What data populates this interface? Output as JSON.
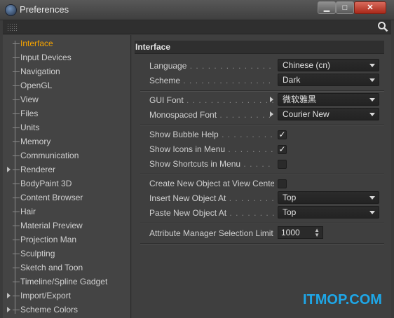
{
  "window": {
    "title": "Preferences",
    "min": "▁",
    "max": "□",
    "close": "✕"
  },
  "sidebar": {
    "items": [
      {
        "label": "Interface",
        "active": true
      },
      {
        "label": "Input Devices"
      },
      {
        "label": "Navigation"
      },
      {
        "label": "OpenGL"
      },
      {
        "label": "View"
      },
      {
        "label": "Files"
      },
      {
        "label": "Units"
      },
      {
        "label": "Memory"
      },
      {
        "label": "Communication"
      },
      {
        "label": "Renderer",
        "expandable": true
      },
      {
        "label": "BodyPaint 3D"
      },
      {
        "label": "Content Browser"
      },
      {
        "label": "Hair"
      },
      {
        "label": "Material Preview"
      },
      {
        "label": "Projection Man"
      },
      {
        "label": "Sculpting"
      },
      {
        "label": "Sketch and Toon"
      },
      {
        "label": "Timeline/Spline Gadget"
      },
      {
        "label": "Import/Export",
        "expandable": true
      },
      {
        "label": "Scheme Colors",
        "expandable": true
      }
    ]
  },
  "main": {
    "section_title": "Interface",
    "language": {
      "label": "Language",
      "dots": " . . . . . . . . . . . . . . . . . . . . . . .",
      "value": "Chinese (cn)"
    },
    "scheme": {
      "label": "Scheme",
      "dots": " . . . . . . . . . . . . . . . . . . . . . . . . . .",
      "value": "Dark"
    },
    "gui_font": {
      "label": "GUI Font",
      "dots": " . . . . . . . . . . . . . . . . . . . . . .",
      "value": "微软雅黑"
    },
    "mono_font": {
      "label": "Monospaced Font",
      "dots": " . . . . . . . . . . .",
      "value": "Courier New"
    },
    "bubble_help": {
      "label": "Show Bubble Help",
      "dots": " . . . . . . . . . . . . . .",
      "check": "✓"
    },
    "icons_menu": {
      "label": "Show Icons in Menu",
      "dots": " . . . . . . . . . . .",
      "check": "✓"
    },
    "shortcuts_menu": {
      "label": "Show Shortcuts in Menu",
      "dots": " . . . . . . . .",
      "check": ""
    },
    "create_view_center": {
      "label": "Create New Object at View Center",
      "check": ""
    },
    "insert_new": {
      "label": "Insert New Object At",
      "dots": " . . . . . . . . . . .",
      "value": "Top"
    },
    "paste_new": {
      "label": "Paste New Object At",
      "dots": " . . . . . . . . . . .",
      "value": "Top"
    },
    "attr_limit": {
      "label": "Attribute Manager Selection Limit",
      "value": "1000"
    }
  },
  "watermark": "ITMOP.COM",
  "colors": {
    "accent": "#f6a400",
    "background": "#3b3b3b",
    "watermark": "#1ea7e8"
  }
}
